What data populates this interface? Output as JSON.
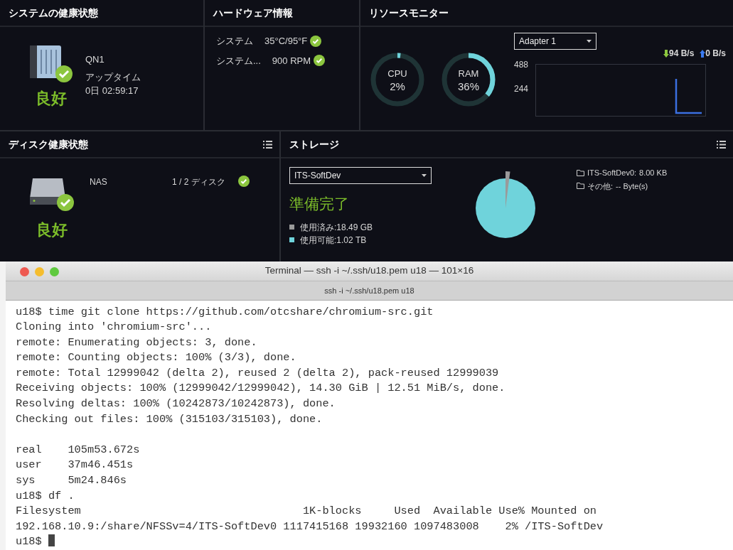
{
  "system_health": {
    "title": "システムの健康状態",
    "device_name": "QN1",
    "uptime_label": "アップタイム",
    "uptime": "0日 02:59:17",
    "status": "良好"
  },
  "hardware_info": {
    "title": "ハードウェア情報",
    "rows": [
      {
        "label": "システム",
        "value": "35°C/95°F",
        "ok": true
      },
      {
        "label": "システム...",
        "value": "900 RPM",
        "ok": true
      }
    ]
  },
  "resource_monitor": {
    "title": "リソースモニター",
    "gauges": [
      {
        "label": "CPU",
        "reading": "2%",
        "level": 0.02
      },
      {
        "label": "RAM",
        "reading": "36%",
        "level": 0.36
      }
    ],
    "adapter": {
      "value": "Adapter 1"
    },
    "download": "94 B/s",
    "upload": "0 B/s",
    "axis_labels": [
      "488",
      "244"
    ]
  },
  "disk_health": {
    "title": "ディスク健康状態",
    "device": "NAS",
    "disks": "1 / 2 ディスク",
    "ok": true,
    "status": "良好"
  },
  "storage": {
    "title": "ストレージ",
    "volume": {
      "value": "ITS-SoftDev"
    },
    "status": "準備完了",
    "level": 0.02,
    "legend": [
      {
        "label": "使用済み:18.49 GB",
        "color": "#9a9a9a"
      },
      {
        "label": "使用可能:1.02 TB",
        "color": "#6fd3db"
      }
    ],
    "folders": [
      {
        "name": "ITS-SoftDev0:",
        "size": "8.00 KB"
      },
      {
        "name": "その他:",
        "size": "-- Byte(s)"
      }
    ]
  },
  "terminal": {
    "title": "Terminal — ssh -i ~/.ssh/u18.pem u18 — 101×16",
    "tab": "ssh -i ~/.ssh/u18.pem u18",
    "blocks": [
      [
        "u18$ time git clone https://github.com/otcshare/chromium-src.git",
        "Cloning into 'chromium-src'...",
        "remote: Enumerating objects: 3, done.",
        "remote: Counting objects: 100% (3/3), done.",
        "remote: Total 12999042 (delta 2), reused 2 (delta 2), pack-reused 12999039",
        "Receiving objects: 100% (12999042/12999042), 14.30 GiB | 12.51 MiB/s, done.",
        "Resolving deltas: 100% (10242873/10242873), done.",
        "Checking out files: 100% (315103/315103), done."
      ],
      [
        "real    105m53.672s",
        "user    37m46.451s",
        "sys     5m24.846s",
        "u18$ df .",
        "Filesystem                                  1K-blocks     Used  Available Use% Mounted on",
        "192.168.10.9:/share/NFSSv=4/ITS-SoftDev0 1117415168 19932160 1097483008    2% /ITS-SoftDev",
        "u18$ "
      ]
    ]
  }
}
